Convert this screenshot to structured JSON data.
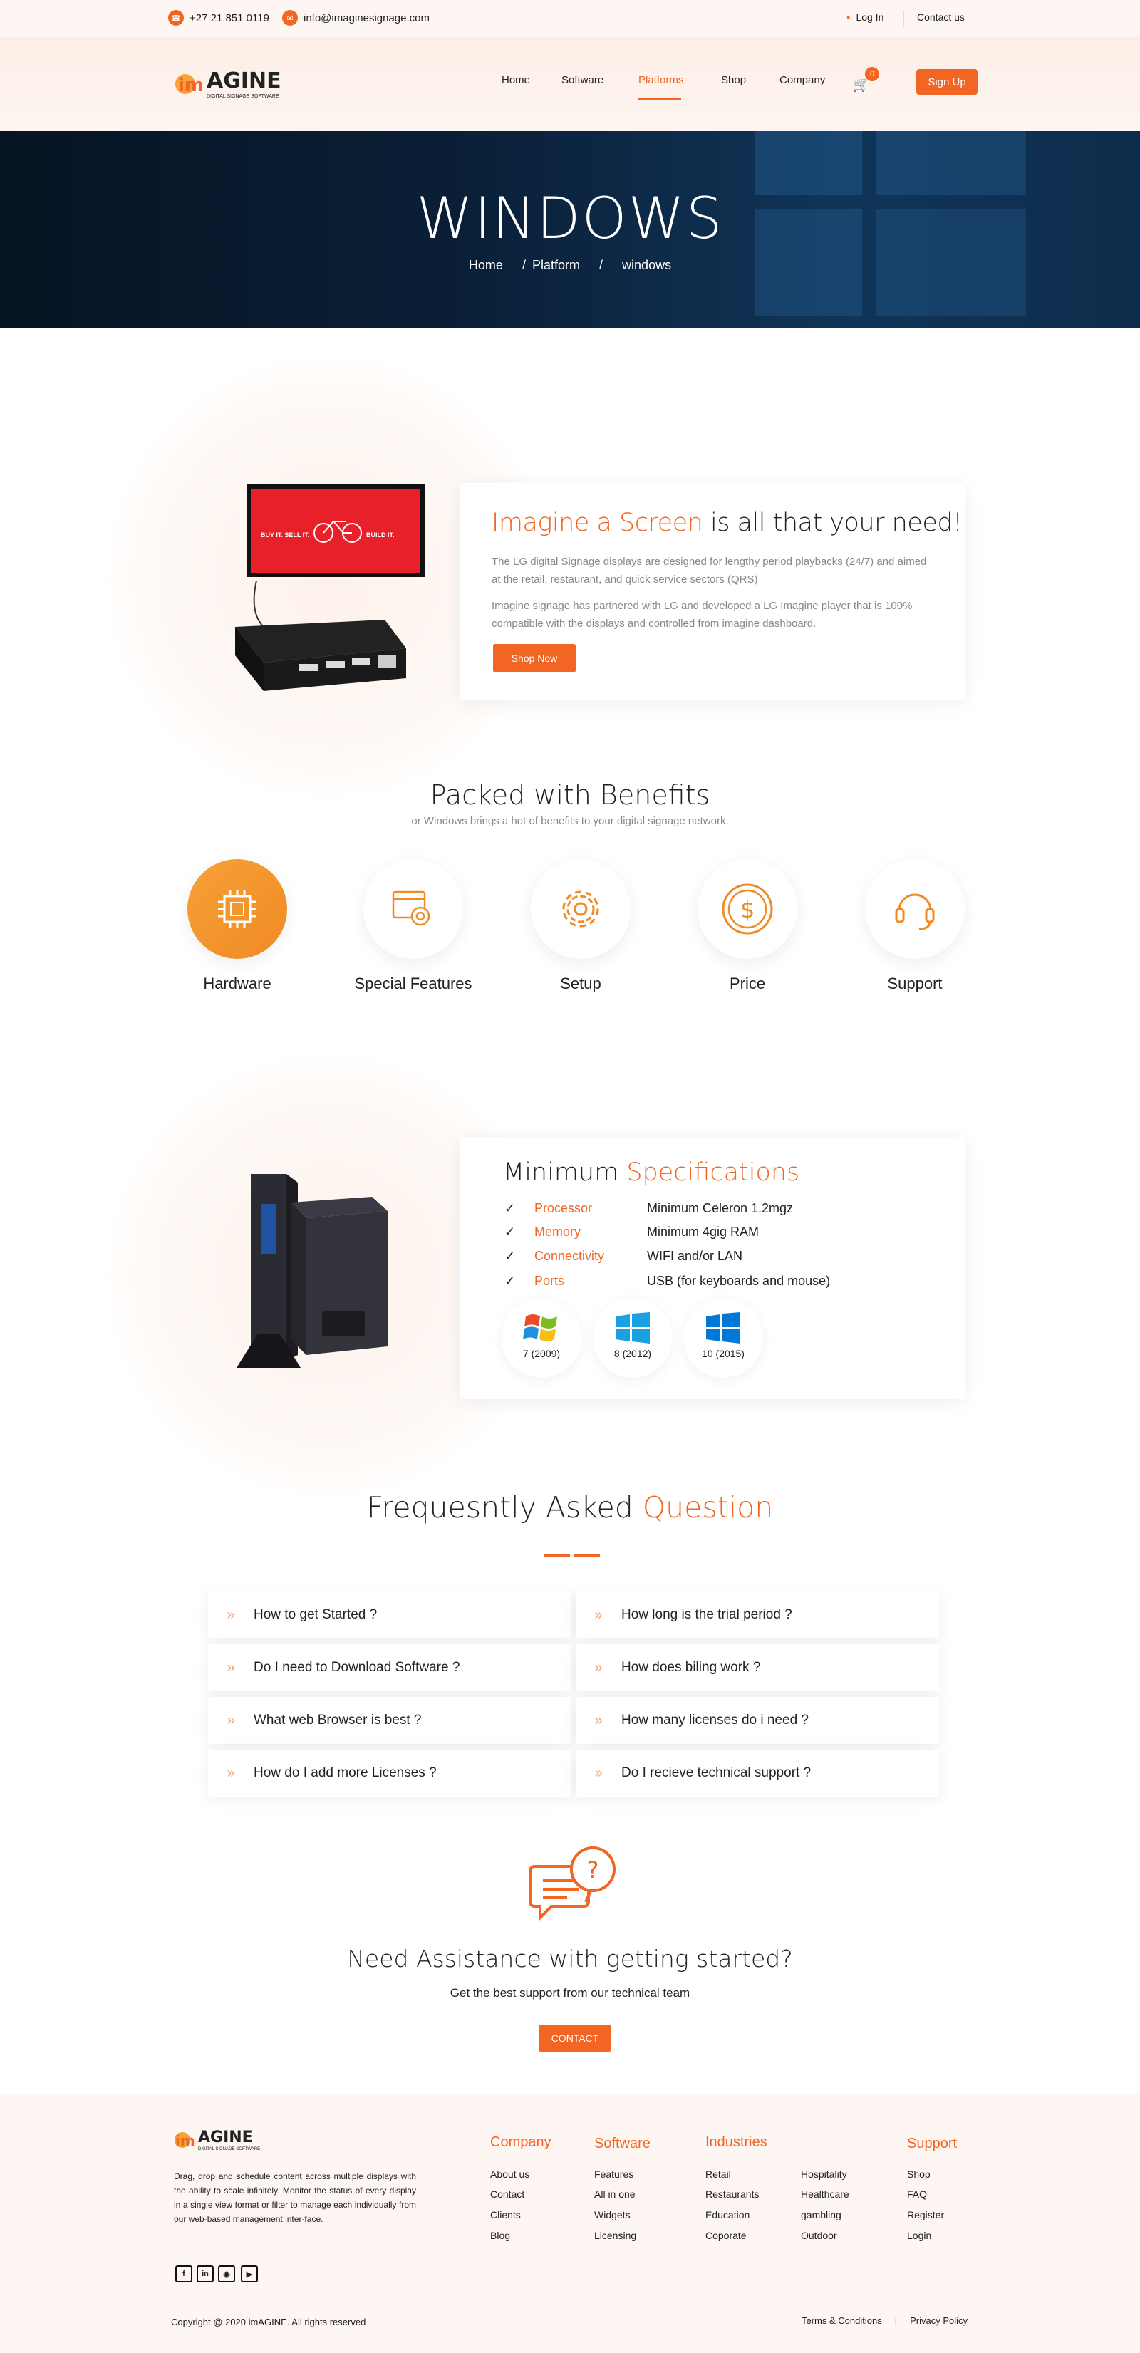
{
  "topbar": {
    "phone": "+27 21 851 0119",
    "email": "info@imaginesignage.com",
    "login": "Log In",
    "contact": "Contact us"
  },
  "brand": {
    "logo_text": "AGINE",
    "tagline": "DIGITAL SIGNAGE SOFTWARE",
    "accent": "#f26522"
  },
  "nav": {
    "items": [
      "Home",
      "Software",
      "Platforms",
      "Shop",
      "Company"
    ],
    "active": "Platforms",
    "cart_count": "0",
    "signup": "Sign Up"
  },
  "hero": {
    "title": "WINDOWS",
    "breadcrumb": [
      "Home",
      "/",
      "Platform",
      "/",
      "windows"
    ]
  },
  "intro": {
    "title_accent": "Imagine a Screen",
    "title_rest": "is all that your need!",
    "p1": "The LG digital Signage displays are designed for lengthy period playbacks (24/7) and aimed at the retail, restaurant, and quick service sectors (QRS)",
    "p2": "Imagine signage has partnered with LG and developed a LG Imagine player that is 100% compatible with the displays and controlled from imagine dashboard.",
    "cta": "Shop Now",
    "screen_text": [
      "BUY IT. SELL IT.",
      "BUILD IT."
    ]
  },
  "benefits": {
    "title": "Packed with Benefits",
    "subtitle": "or Windows brings a hot of benefits to your digital signage network.",
    "items": [
      {
        "label": "Hardware",
        "icon": "chip-icon"
      },
      {
        "label": "Special Features",
        "icon": "browser-gear-icon"
      },
      {
        "label": "Setup",
        "icon": "gear-icon"
      },
      {
        "label": "Price",
        "icon": "dollar-coin-icon"
      },
      {
        "label": "Support",
        "icon": "headset-icon"
      }
    ]
  },
  "specs": {
    "title_plain": "Minimum",
    "title_accent": "Specifications",
    "rows": [
      {
        "key": "Processor",
        "value": "Minimum Celeron 1.2mgz"
      },
      {
        "key": "Memory",
        "value": "Minimum 4gig RAM"
      },
      {
        "key": "Connectivity",
        "value": "WIFI and/or LAN"
      },
      {
        "key": "Ports",
        "value": "USB (for keyboards and mouse)"
      }
    ],
    "versions": [
      "7 (2009)",
      "8 (2012)",
      "10 (2015)"
    ]
  },
  "faq": {
    "title_plain": "Frequesntly Asked",
    "title_accent": "Question",
    "items": [
      "How to get Started ?",
      "How long is the trial period ?",
      "Do I need to Download Software ?",
      "How does biling work ?",
      "What web Browser is best ?",
      "How many licenses do i need ?",
      "How do I add more Licenses ?",
      "Do I recieve technical support ?"
    ]
  },
  "assist": {
    "title": "Need Assistance with getting started?",
    "subtitle": "Get the best support from our technical team",
    "cta": "CONTACT"
  },
  "footer": {
    "description": "Drag, drop and schedule content across multiple displays with the ability to scale infinitely. Monitor the status of every display in a single view format or filter to manage each individually from our web-based management inter-face.",
    "columns": [
      {
        "title": "Company",
        "links": [
          "About us",
          "Contact",
          "Clients",
          "Blog"
        ]
      },
      {
        "title": "Software",
        "links": [
          "Features",
          "All in one",
          "Widgets",
          "Licensing"
        ]
      },
      {
        "title": "Industries",
        "links": [
          "Retail",
          "Restaurants",
          "Education",
          "Coporate"
        ],
        "links2": [
          "Hospitality",
          "Healthcare",
          "gambling",
          "Outdoor"
        ]
      },
      {
        "title": "Support",
        "links": [
          "Shop",
          "FAQ",
          "Register",
          "Login"
        ]
      }
    ],
    "social": [
      "facebook-icon",
      "linkedin-icon",
      "instagram-icon",
      "youtube-icon"
    ],
    "copyright": "Copyright @ 2020 imAGINE. All rights reserved",
    "terms": "Terms & Conditions",
    "sep": "|",
    "privacy": "Privacy Policy"
  }
}
